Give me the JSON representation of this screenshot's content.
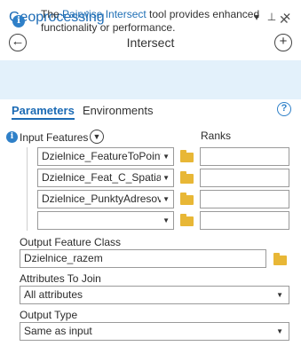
{
  "window": {
    "title": "Geoprocessing",
    "menu_glyph": "▾",
    "pin_glyph": "⊥",
    "close_glyph": "✕"
  },
  "nav": {
    "back_glyph": "←",
    "tool_name": "Intersect",
    "add_glyph": "+"
  },
  "banner": {
    "text_before": "The ",
    "link": "Pairwise Intersect",
    "text_after": " tool provides enhanced functionality or performance.",
    "close_glyph": "✕"
  },
  "tabs": {
    "parameters": "Parameters",
    "environments": "Environments",
    "help_glyph": "?"
  },
  "input_features": {
    "label": "Input Features",
    "ranks_label": "Ranks",
    "rows": [
      {
        "value": "Dzielnice_FeatureToPoint",
        "rank": ""
      },
      {
        "value": "Dzielnice_Feat_C_SpatialJ",
        "rank": ""
      },
      {
        "value": "Dzielnice_PunktyAdresov",
        "rank": ""
      },
      {
        "value": "",
        "rank": ""
      }
    ]
  },
  "output_feature_class": {
    "label": "Output Feature Class",
    "value": "Dzielnice_razem"
  },
  "attributes_to_join": {
    "label": "Attributes To Join",
    "value": "All attributes"
  },
  "output_type": {
    "label": "Output Type",
    "value": "Same as input"
  },
  "colors": {
    "accent": "#1c6bb5",
    "banner_bg": "#e3f1fb",
    "folder": "#e8b736"
  }
}
